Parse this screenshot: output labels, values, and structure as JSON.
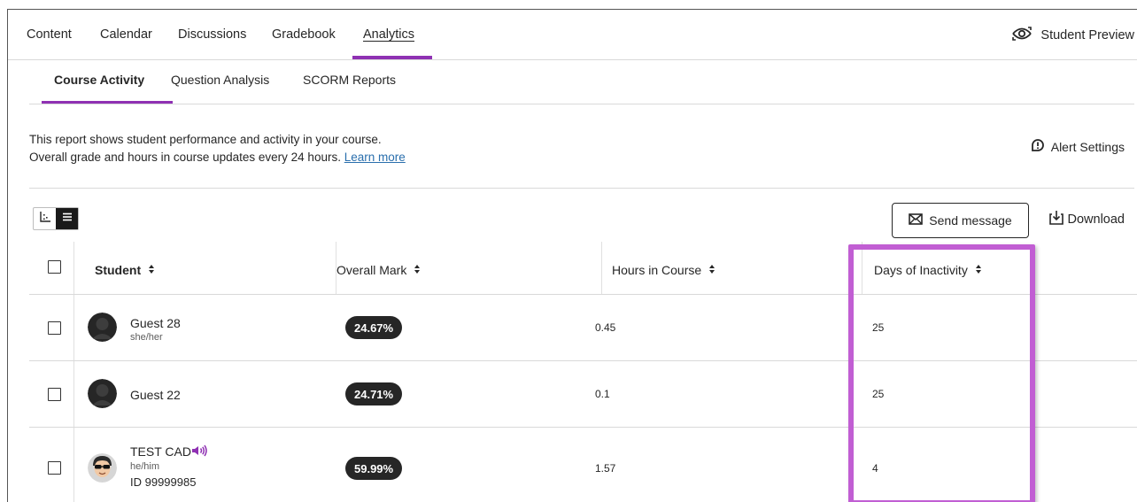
{
  "nav": {
    "tabs": [
      "Content",
      "Calendar",
      "Discussions",
      "Gradebook",
      "Analytics"
    ],
    "active_tab": "Analytics",
    "student_preview": "Student Preview"
  },
  "subtabs": {
    "items": [
      "Course Activity",
      "Question Analysis",
      "SCORM Reports"
    ],
    "active": "Course Activity"
  },
  "description": {
    "line1": "This report shows student performance and activity in your course.",
    "line2": "Overall grade and hours in course updates every 24 hours.",
    "learn_more": "Learn more"
  },
  "alert_settings": "Alert Settings",
  "toolbar": {
    "send_message": "Send message",
    "download": "Download"
  },
  "table": {
    "columns": [
      "Student",
      "Overall Mark",
      "Hours in Course",
      "Days of Inactivity"
    ],
    "rows": [
      {
        "name": "Guest 28",
        "pronouns": "she/her",
        "id": "",
        "mark": "24.67%",
        "hours": "0.45",
        "inactive_days": "25",
        "avatar": "silhouette-avatar"
      },
      {
        "name": "Guest 22",
        "pronouns": "",
        "id": "",
        "mark": "24.71%",
        "hours": "0.1",
        "inactive_days": "25",
        "avatar": "silhouette-avatar"
      },
      {
        "name": "TEST CAD",
        "pronouns": "he/him",
        "id": "ID 99999985",
        "mark": "59.99%",
        "hours": "1.57",
        "inactive_days": "4",
        "avatar": "cartoon-avatar",
        "audio_icon": "speaker-icon"
      }
    ]
  },
  "colors": {
    "accent": "#8f31b3",
    "highlight": "#c15ed3",
    "badge": "#262626",
    "link": "#2a6fad"
  }
}
